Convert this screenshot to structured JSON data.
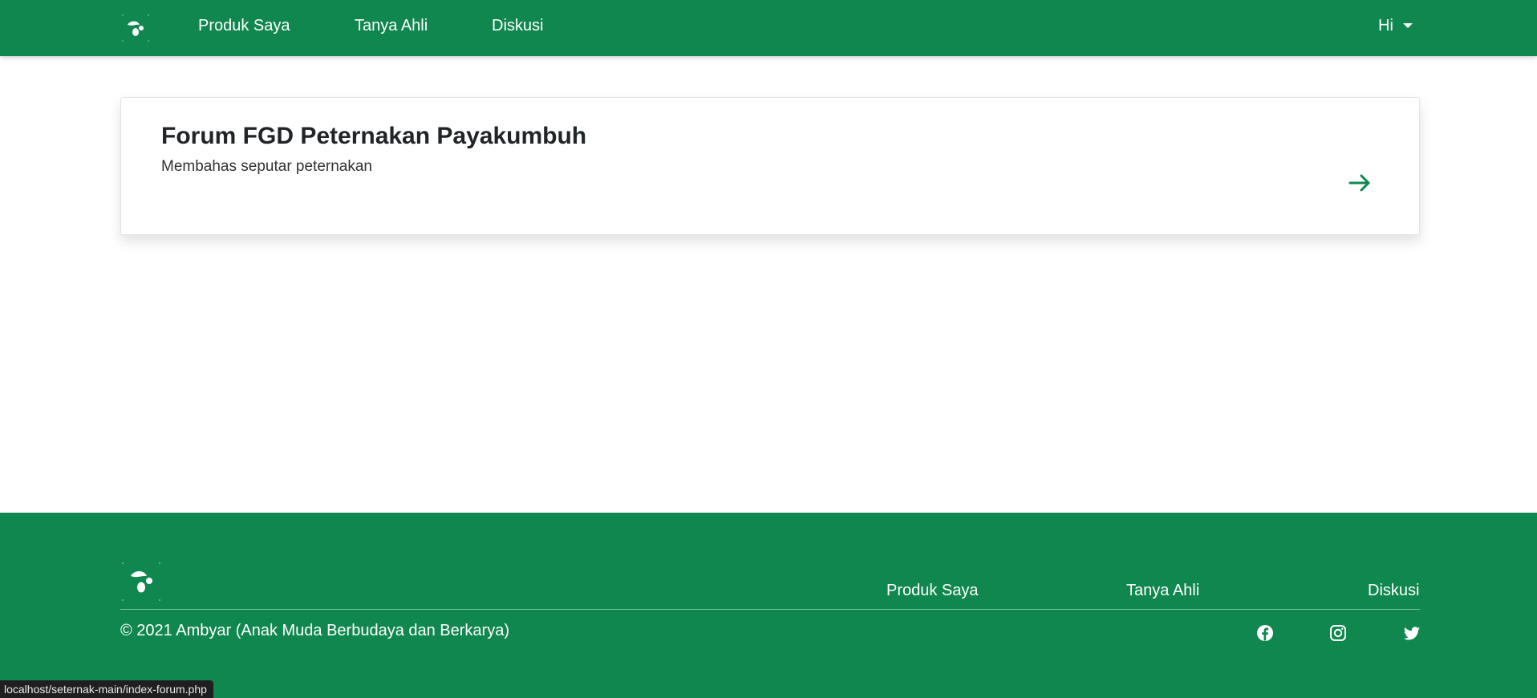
{
  "navbar": {
    "logo_icon": "leaf-dots-logo-icon",
    "links": [
      "Produk Saya",
      "Tanya Ahli",
      "Diskusi"
    ],
    "user_label": "Hi"
  },
  "forum": {
    "title": "Forum FGD Peternakan Payakumbuh",
    "description": "Membahas seputar peternakan",
    "arrow_icon": "arrow-right-icon"
  },
  "footer": {
    "links": [
      "Produk Saya",
      "Tanya Ahli",
      "Diskusi"
    ],
    "copyright": "© 2021 Ambyar (Anak Muda Berbudaya dan Berkarya)",
    "social_icons": [
      "facebook-icon",
      "instagram-icon",
      "twitter-icon"
    ]
  },
  "status_bar": {
    "url": "localhost/seternak-main/index-forum.php"
  },
  "colors": {
    "brand_green": "#10874f",
    "text_dark": "#212529",
    "white": "#ffffff"
  }
}
